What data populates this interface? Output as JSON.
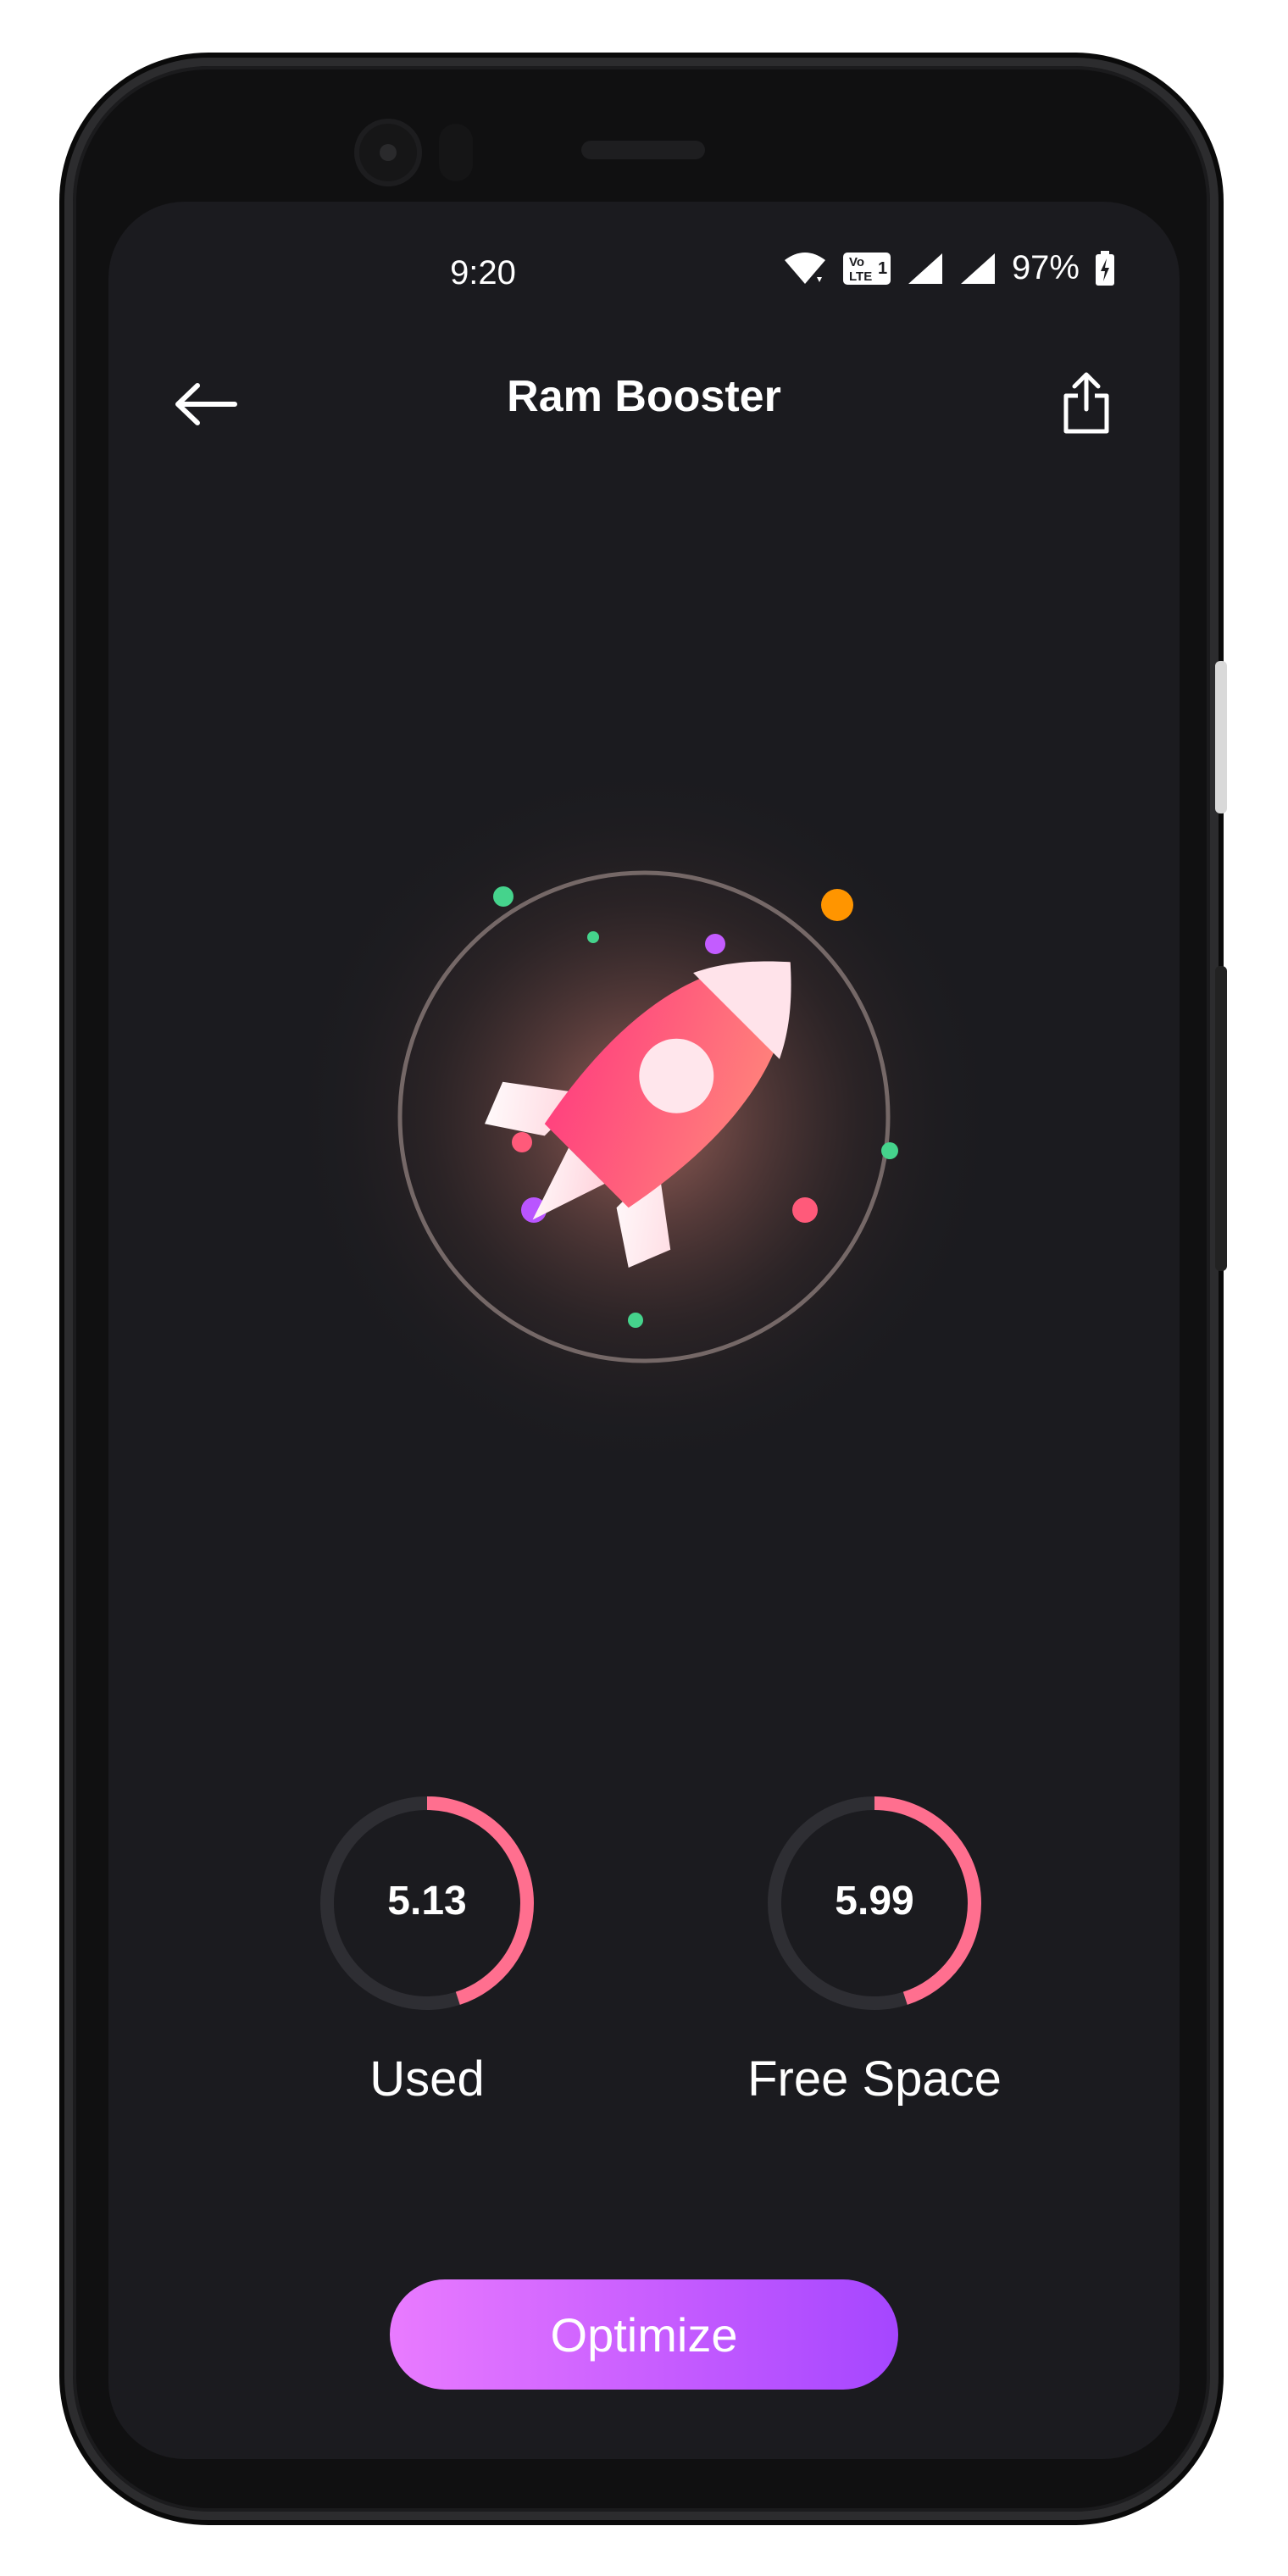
{
  "status_bar": {
    "time": "9:20",
    "battery": "97%"
  },
  "app_bar": {
    "title": "Ram Booster"
  },
  "stats": {
    "used": {
      "value": "5.13",
      "label": "Used",
      "progress": 0.45
    },
    "free": {
      "value": "5.99",
      "label": "Free Space",
      "progress": 0.45
    }
  },
  "actions": {
    "optimize_label": "Optimize"
  },
  "colors": {
    "background": "#1b1b1f",
    "accent_pink": "#ff4f86",
    "accent_purple": "#c65cff",
    "ring_track": "#2e2e33"
  },
  "icons": {
    "back": "arrow-left-icon",
    "share": "share-icon",
    "hero": "rocket-icon"
  }
}
